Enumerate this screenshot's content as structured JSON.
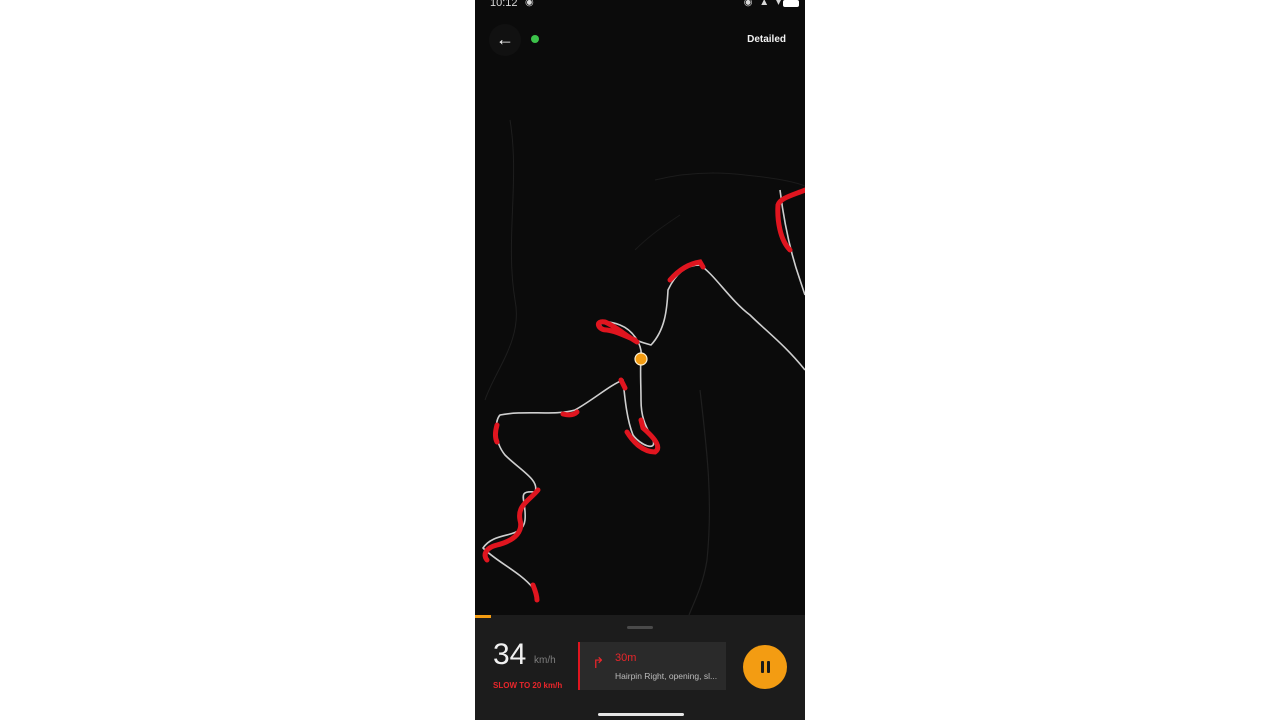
{
  "status_bar": {
    "time": "10:12",
    "battery_color": "#ffffff"
  },
  "header": {
    "back_icon": "arrow-left-icon",
    "gps_status_color": "#3cc24a",
    "mode_label": "Detailed"
  },
  "map": {
    "background_color": "#0b0b0b",
    "road_color": "#cfcfcf",
    "curve_highlight_color": "#e0151f",
    "position_marker_color": "#f39c12"
  },
  "bottom_panel": {
    "speed": "34",
    "speed_unit": "km/h",
    "speed_warning": "SLOW TO 20 km/h",
    "instruction": {
      "turn_icon": "turn-right-icon",
      "distance": "30m",
      "text": "Hairpin Right, opening, sl..."
    },
    "pause_icon": "pause-icon",
    "accent_color": "#f39c12",
    "warning_color": "#e8262b"
  }
}
